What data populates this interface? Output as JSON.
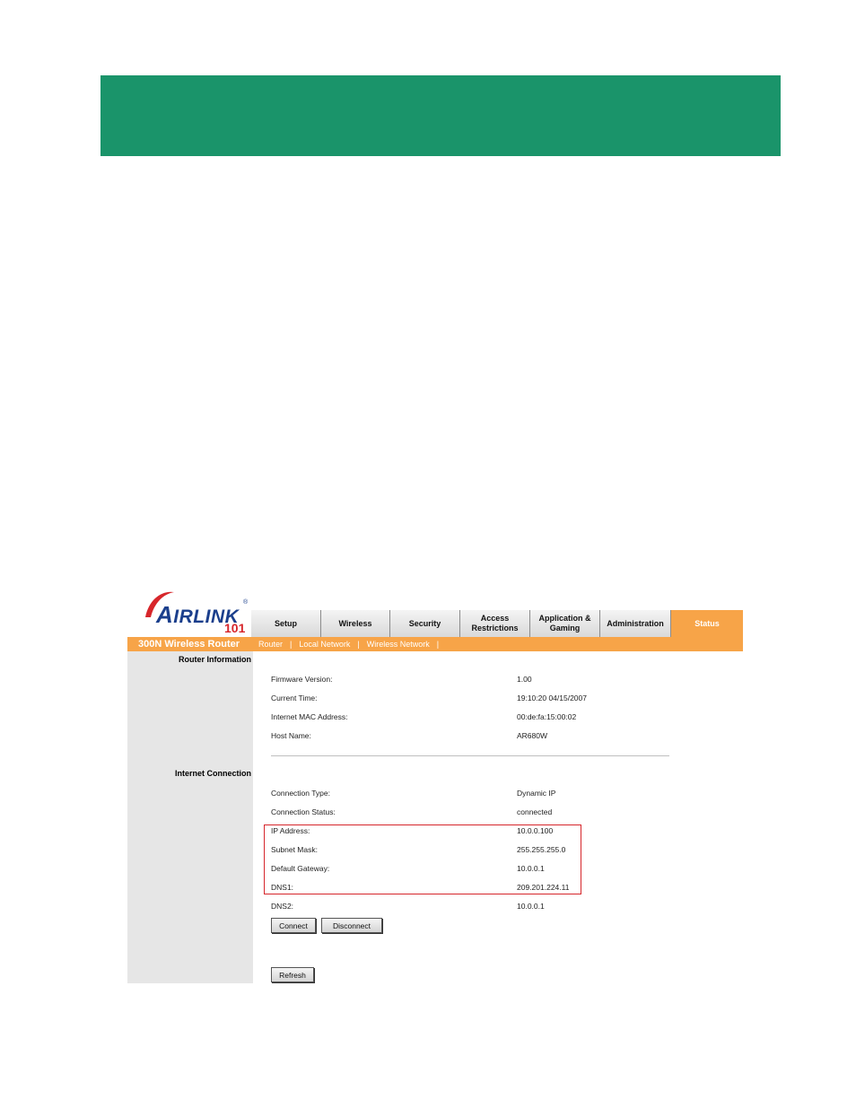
{
  "logo": {
    "brand_prefix": "A",
    "brand_rest": "IRLINK",
    "registered": "®",
    "number": "101"
  },
  "nav": {
    "tabs": [
      {
        "label": "Setup",
        "active": false
      },
      {
        "label": "Wireless",
        "active": false
      },
      {
        "label": "Security",
        "active": false
      },
      {
        "label": "Access\nRestrictions",
        "active": false
      },
      {
        "label": "Application &\nGaming",
        "active": false
      },
      {
        "label": "Administration",
        "active": false
      },
      {
        "label": "Status",
        "active": true
      }
    ]
  },
  "subbar": {
    "product": "300N Wireless Router",
    "links": [
      "Router",
      "Local Network",
      "Wireless Network"
    ],
    "separator": "|"
  },
  "sections": {
    "router_info": "Router Information",
    "internet_connection": "Internet Connection"
  },
  "router_info": [
    {
      "label": "Firmware Version:",
      "value": "1.00"
    },
    {
      "label": "Current Time:",
      "value": "19:10:20 04/15/2007"
    },
    {
      "label": "Internet MAC Address:",
      "value": "00:de:fa:15:00:02"
    },
    {
      "label": "Host Name:",
      "value": "AR680W"
    }
  ],
  "internet_connection": [
    {
      "label": "Connection Type:",
      "value": "Dynamic IP"
    },
    {
      "label": "Connection Status:",
      "value": "connected"
    },
    {
      "label": "IP Address:",
      "value": "10.0.0.100"
    },
    {
      "label": "Subnet Mask:",
      "value": "255.255.255.0"
    },
    {
      "label": "Default Gateway:",
      "value": "10.0.0.1"
    },
    {
      "label": "DNS1:",
      "value": "209.201.224.11"
    },
    {
      "label": "DNS2:",
      "value": "10.0.0.1"
    }
  ],
  "buttons": {
    "connect": "Connect",
    "disconnect": "Disconnect",
    "refresh": "Refresh"
  },
  "colors": {
    "banner": "#1a946a",
    "accent": "#f7a448",
    "highlight": "#d6262b",
    "brand": "#1b3f8c"
  }
}
